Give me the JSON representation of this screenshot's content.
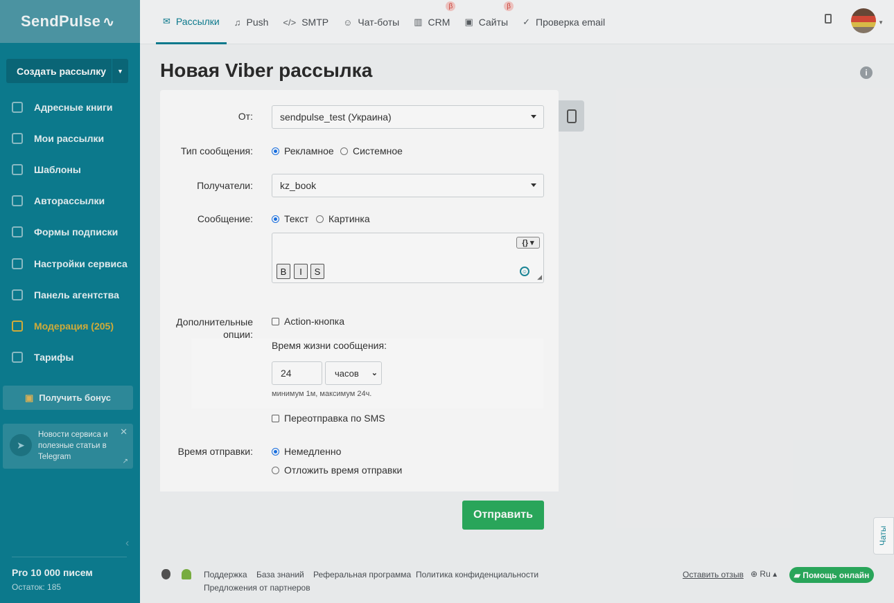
{
  "brand": {
    "name": "SendPulse",
    "pulse_glyph": "∿"
  },
  "sidebar": {
    "create_button": "Создать рассылку",
    "items": [
      {
        "label": "Адресные книги",
        "icon": "book-icon"
      },
      {
        "label": "Мои рассылки",
        "icon": "campaigns-icon"
      },
      {
        "label": "Шаблоны",
        "icon": "templates-icon"
      },
      {
        "label": "Авторассылки",
        "icon": "automation-icon"
      },
      {
        "label": "Формы подписки",
        "icon": "forms-icon"
      },
      {
        "label": "Настройки сервиса",
        "icon": "settings-icon"
      },
      {
        "label": "Панель агентства",
        "icon": "agency-icon"
      },
      {
        "label": "Модерация (205)",
        "icon": "moderation-icon"
      },
      {
        "label": "Тарифы",
        "icon": "pricing-icon"
      }
    ],
    "bonus_button": "Получить бонус",
    "telegram_text": "Новости сервиса и полезные статьи в Telegram",
    "plan": "Pro 10 000 писем",
    "remaining": "Остаток: 185"
  },
  "topnav": {
    "tabs": [
      {
        "label": "Рассылки",
        "icon": "✉"
      },
      {
        "label": "Push",
        "icon": "🔔"
      },
      {
        "label": "SMTP",
        "icon": "</>"
      },
      {
        "label": "Чат-боты",
        "icon": "☺"
      },
      {
        "label": "CRM",
        "icon": "▥",
        "beta": "β"
      },
      {
        "label": "Сайты",
        "icon": "▣",
        "beta": "β"
      },
      {
        "label": "Проверка email",
        "icon": "✓"
      }
    ]
  },
  "page": {
    "title": "Новая Viber рассылка"
  },
  "form": {
    "from_label": "От:",
    "from_value": "sendpulse_test (Украина)",
    "type_label": "Тип сообщения:",
    "type_promo": "Рекламное",
    "type_system": "Системное",
    "recipients_label": "Получатели:",
    "recipients_value": "kz_book",
    "message_label": "Сообщение:",
    "message_text": "Текст",
    "message_image": "Картинка",
    "var_button": "{}",
    "fmt_bold": "B",
    "fmt_italic": "I",
    "fmt_strike": "S",
    "extra_label_1": "Дополнительные",
    "extra_label_2": "опции:",
    "action_button": "Action-кнопка",
    "ttl_label": "Время жизни сообщения:",
    "ttl_value": "24",
    "ttl_unit": "часов",
    "ttl_hint": "минимум 1м, максимум 24ч.",
    "sms_resend": "Переотправка по SMS",
    "send_time_label": "Время отправки:",
    "send_now": "Немедленно",
    "send_later": "Отложить время отправки",
    "submit": "Отправить"
  },
  "footer": {
    "links": [
      "Поддержка",
      "База знаний",
      "Реферальная программа",
      "Политика конфиденциальности",
      "Предложения от партнеров"
    ],
    "feedback": "Оставить отзыв",
    "lang": "Ru",
    "help": "Помощь онлайн",
    "chats": "Чаты"
  },
  "colors": {
    "sidebar": "#0d7e92",
    "accent_green": "#2bac5e",
    "moderation": "#d9b23c"
  }
}
